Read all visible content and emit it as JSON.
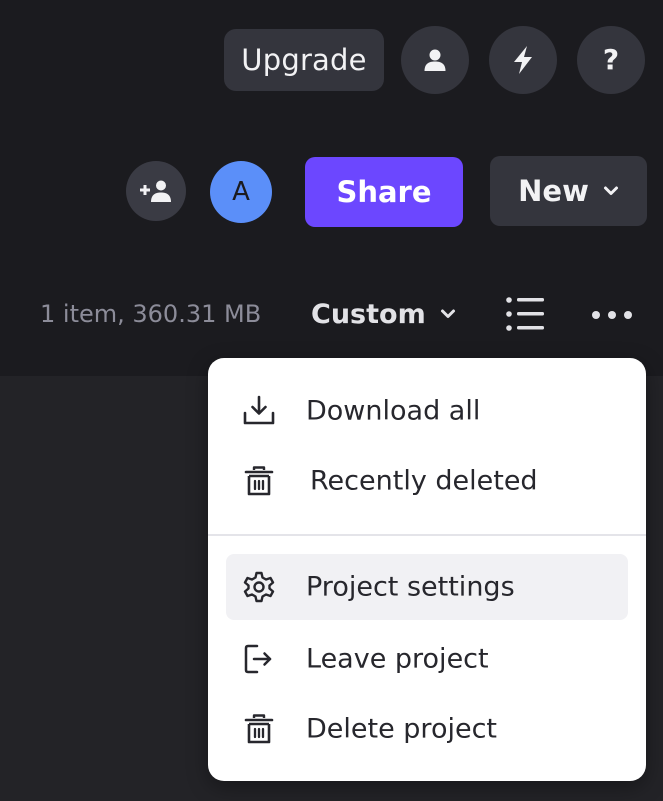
{
  "header": {
    "upgrade_label": "Upgrade",
    "help_label": "?",
    "icons": [
      "user-icon",
      "lightning-icon",
      "help-icon"
    ]
  },
  "actions": {
    "invite_icon": "add-user-icon",
    "avatar_initial": "A",
    "share_label": "Share",
    "new_label": "New"
  },
  "info_bar": {
    "item_count": "1 item, 360.31 MB",
    "sort_label": "Custom",
    "view_icon": "list-view-icon",
    "more_icon": "more-horizontal-icon"
  },
  "menu": {
    "items": [
      {
        "label": "Download all",
        "icon": "download-icon"
      },
      {
        "label": "Recently deleted",
        "icon": "trash-icon"
      },
      {
        "label": "Project settings",
        "icon": "gear-icon",
        "highlighted": true
      },
      {
        "label": "Leave project",
        "icon": "exit-icon"
      },
      {
        "label": "Delete project",
        "icon": "trash-icon"
      }
    ]
  },
  "colors": {
    "background": "#1b1b1f",
    "button": "#34353d",
    "accent": "#6c47ff",
    "avatar": "#5b8ff9",
    "menu_bg": "#ffffff",
    "menu_highlight": "#f1f1f4",
    "muted_text": "#8c8c99"
  }
}
